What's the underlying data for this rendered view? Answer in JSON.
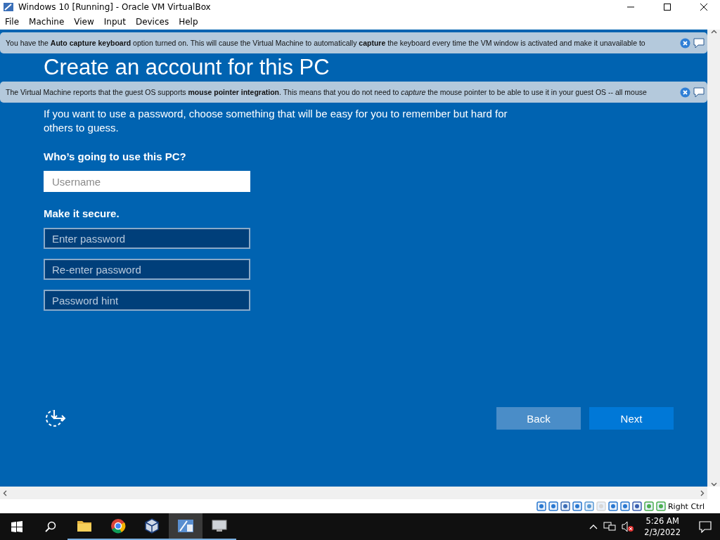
{
  "window": {
    "title": "Windows 10 [Running] - Oracle VM VirtualBox"
  },
  "menu": [
    "File",
    "Machine",
    "View",
    "Input",
    "Devices",
    "Help"
  ],
  "notifications": [
    {
      "text": "You have the **Auto capture keyboard** option turned on. This will cause the Virtual Machine to automatically **capture** the keyboard every time the VM window is activated and make it unavailable to"
    },
    {
      "text": "The Virtual Machine reports that the guest OS supports **mouse pointer integration**. This means that you do not need to *capture* the mouse pointer to be able to use it in your guest OS -- all mouse"
    }
  ],
  "setup": {
    "title": "Create an account for this PC",
    "description": "If you want to use a password, choose something that will be easy for you to remember but hard for others to guess.",
    "user_heading": "Who’s going to use this PC?",
    "user_fields": [
      {
        "placeholder": "Username",
        "focused": true
      }
    ],
    "secure_heading": "Make it secure.",
    "secure_fields": [
      {
        "placeholder": "Enter password",
        "focused": false
      },
      {
        "placeholder": "Re-enter password",
        "focused": false
      },
      {
        "placeholder": "Password hint",
        "focused": false
      }
    ],
    "buttons": [
      {
        "label": "Back",
        "kind": "secondary"
      },
      {
        "label": "Next",
        "kind": "primary"
      }
    ]
  },
  "status_bar": {
    "host_key": "Right Ctrl"
  },
  "taskbar": {
    "apps": [
      {
        "kind": "folder",
        "selected": false
      },
      {
        "kind": "browser",
        "selected": false
      },
      {
        "kind": "cube",
        "selected": false
      },
      {
        "kind": "app",
        "selected": true
      },
      {
        "kind": "monitor",
        "selected": false
      }
    ],
    "time": "5:26 AM",
    "date": "2/3/2022"
  }
}
